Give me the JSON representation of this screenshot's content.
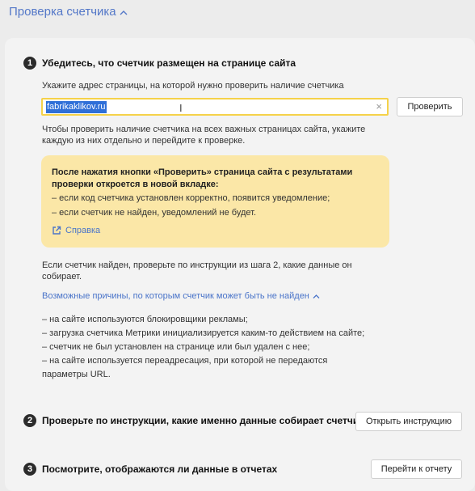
{
  "header": {
    "title": "Проверка счетчика"
  },
  "step1": {
    "number": "1",
    "title": "Убедитесь, что счетчик размещен на странице сайта",
    "prompt": "Укажите адрес страницы, на которой нужно проверить наличие счетчика",
    "url_value": "fabrikaklikov.ru",
    "check_button": "Проверить",
    "hint_line1": "Чтобы проверить наличие счетчика на всех важных страницах сайта, укажите",
    "hint_line2": "каждую из них отдельно и перейдите к проверке.",
    "notice": {
      "bold_line1": "После нажатия кнопки «Проверить» страница сайта с результатами",
      "bold_line2": "проверки откроется в новой вкладке:",
      "item1": "– если код счетчика установлен корректно, появится уведомление;",
      "item2": "– если счетчик не найден, уведомлений не будет.",
      "help_label": "Справка"
    },
    "found_line1": "Если счетчик найден, проверьте по инструкции из шага 2, какие данные он",
    "found_line2": "собирает.",
    "reasons_link": "Возможные причины, по которым счетчик может быть не найден",
    "reasons": [
      "– на сайте используются блокировщики рекламы;",
      "– загрузка счетчика Метрики инициализируется каким-то действием на сайте;",
      "– счетчик не был установлен на странице или был удален с нее;",
      "– на сайте используется переадресация, при которой не передаются",
      "параметры URL."
    ]
  },
  "step2": {
    "number": "2",
    "title": "Проверьте по инструкции, какие именно данные собирает счетчик",
    "button": "Открыть инструкцию"
  },
  "step3": {
    "number": "3",
    "title": "Посмотрите, отображаются ли данные в отчетах",
    "button": "Перейти к отчету"
  },
  "colors": {
    "accent": "#f5d24a",
    "link": "#4a74c9",
    "notice_bg": "#fbe7a7"
  }
}
